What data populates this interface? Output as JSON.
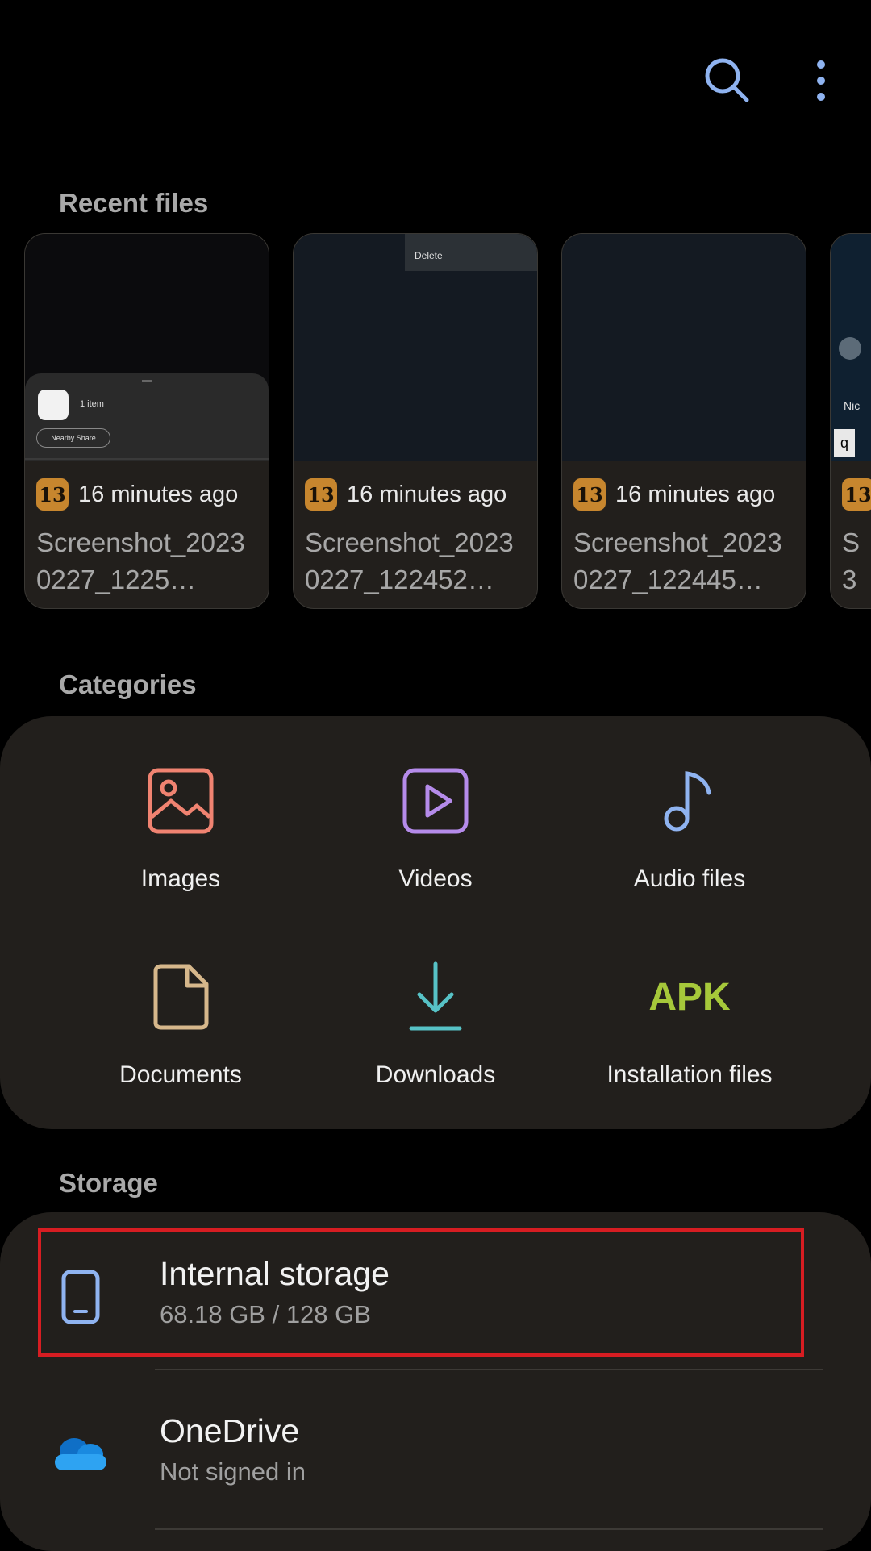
{
  "sections": {
    "recent": "Recent files",
    "categories": "Categories",
    "storage": "Storage"
  },
  "recent_files": [
    {
      "time": "16 minutes ago",
      "name": "Screenshot_20230227_1225…",
      "thumb_text_1": "1 item",
      "thumb_text_2": "Nearby Share"
    },
    {
      "time": "16 minutes ago",
      "name": "Screenshot_20230227_122452…",
      "thumb_text_1": "Delete"
    },
    {
      "time": "16 minutes ago",
      "name": "Screenshot_20230227_122445…"
    },
    {
      "time": "",
      "name": "S\n3",
      "thumb_text_1": "Nic",
      "thumb_text_2": "q"
    }
  ],
  "app_badge": "13",
  "categories": [
    {
      "label": "Images",
      "icon": "image-icon",
      "color": "#f08371"
    },
    {
      "label": "Videos",
      "icon": "video-icon",
      "color": "#b58bea"
    },
    {
      "label": "Audio files",
      "icon": "music-note-icon",
      "color": "#8fb3f0"
    },
    {
      "label": "Documents",
      "icon": "document-icon",
      "color": "#d6b78b"
    },
    {
      "label": "Downloads",
      "icon": "download-icon",
      "color": "#57c2c6"
    },
    {
      "label": "Installation files",
      "icon": "apk-icon",
      "icon_text": "APK",
      "color": "#a6c83a"
    }
  ],
  "storage": [
    {
      "title": "Internal storage",
      "subtitle": "68.18 GB / 128 GB",
      "icon": "phone-icon"
    },
    {
      "title": "OneDrive",
      "subtitle": "Not signed in",
      "icon": "onedrive-cloud-icon"
    }
  ],
  "colors": {
    "highlight": "#d71d22",
    "accent_icon": "#8fb3f0"
  }
}
